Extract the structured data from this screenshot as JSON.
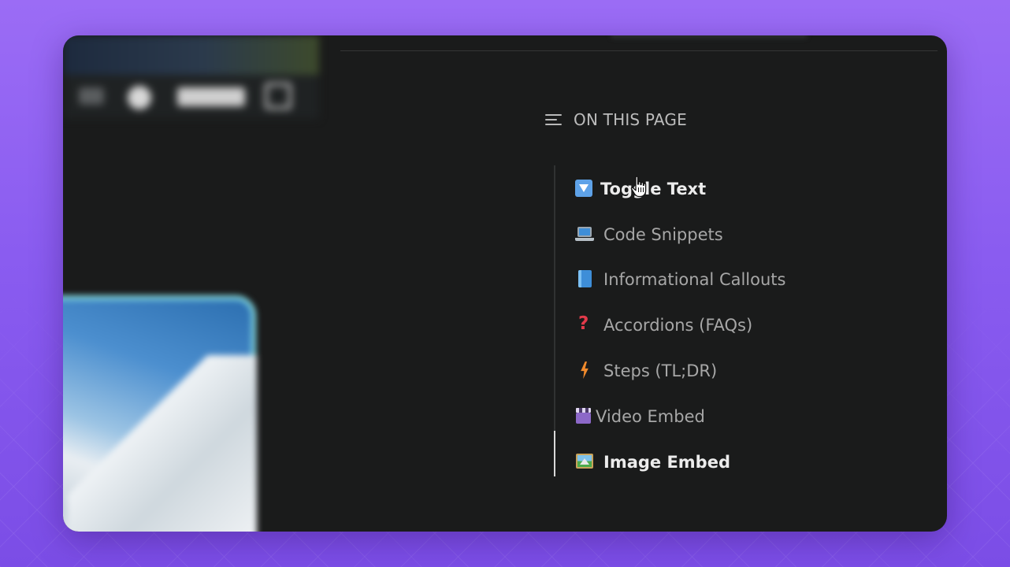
{
  "toc": {
    "header_label": "ON THIS PAGE",
    "items": [
      {
        "label": "Toggle Text",
        "icon": "down-arrow-button-emoji",
        "state": "hovered"
      },
      {
        "label": "Code Snippets",
        "icon": "laptop-emoji",
        "state": "normal"
      },
      {
        "label": "Informational Callouts",
        "icon": "blue-book-emoji",
        "state": "normal"
      },
      {
        "label": "Accordions (FAQs)",
        "icon": "question-mark-emoji",
        "state": "normal"
      },
      {
        "label": "Steps (TL;DR)",
        "icon": "lightning-emoji",
        "state": "normal"
      },
      {
        "label": "Video Embed",
        "icon": "clapper-board-emoji",
        "state": "normal"
      },
      {
        "label": "Image Embed",
        "icon": "framed-picture-emoji",
        "state": "active"
      }
    ]
  },
  "colors": {
    "background_top": "#9b6cf5",
    "background_bottom": "#7b4de6",
    "window": "#1a1b1b",
    "text_muted": "#a7a7a7",
    "text_bright": "#ececec",
    "active_bar": "#d8d8d8"
  }
}
